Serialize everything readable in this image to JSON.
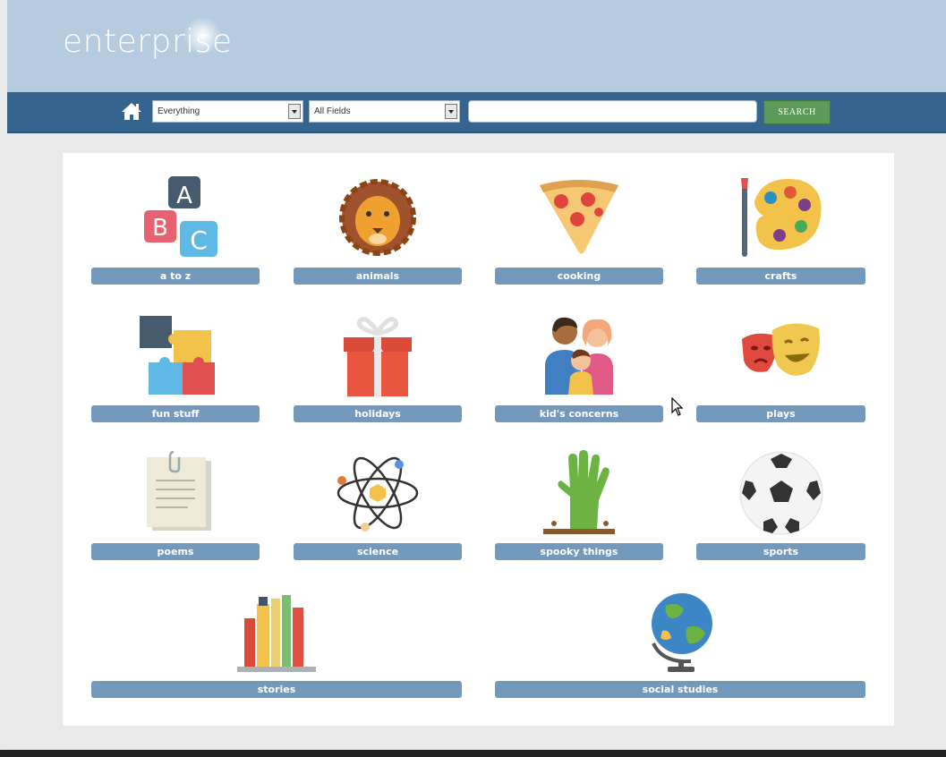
{
  "header": {
    "logo_text": "enterprise"
  },
  "navbar": {
    "home_icon": "home-icon",
    "scope_select": "Everything",
    "field_select": "All Fields",
    "search_value": "",
    "search_button": "SEARCH"
  },
  "categories": [
    {
      "label": "a to z",
      "icon": "abc-blocks-icon"
    },
    {
      "label": "animals",
      "icon": "lion-icon"
    },
    {
      "label": "cooking",
      "icon": "pizza-icon"
    },
    {
      "label": "crafts",
      "icon": "paint-palette-icon"
    },
    {
      "label": "fun stuff",
      "icon": "puzzle-icon"
    },
    {
      "label": "holidays",
      "icon": "gift-icon"
    },
    {
      "label": "kid's concerns",
      "icon": "family-icon"
    },
    {
      "label": "plays",
      "icon": "theater-masks-icon"
    },
    {
      "label": "poems",
      "icon": "notepad-icon"
    },
    {
      "label": "science",
      "icon": "atom-icon"
    },
    {
      "label": "spooky things",
      "icon": "zombie-hand-icon"
    },
    {
      "label": "sports",
      "icon": "soccer-ball-icon"
    },
    {
      "label": "stories",
      "icon": "books-icon"
    },
    {
      "label": "social studies",
      "icon": "globe-icon"
    }
  ],
  "colors": {
    "header_bg": "#b4cbe0",
    "navbar_bg": "#35658f",
    "label_bg": "#7399bd",
    "search_button_bg": "#5d9a5a"
  }
}
